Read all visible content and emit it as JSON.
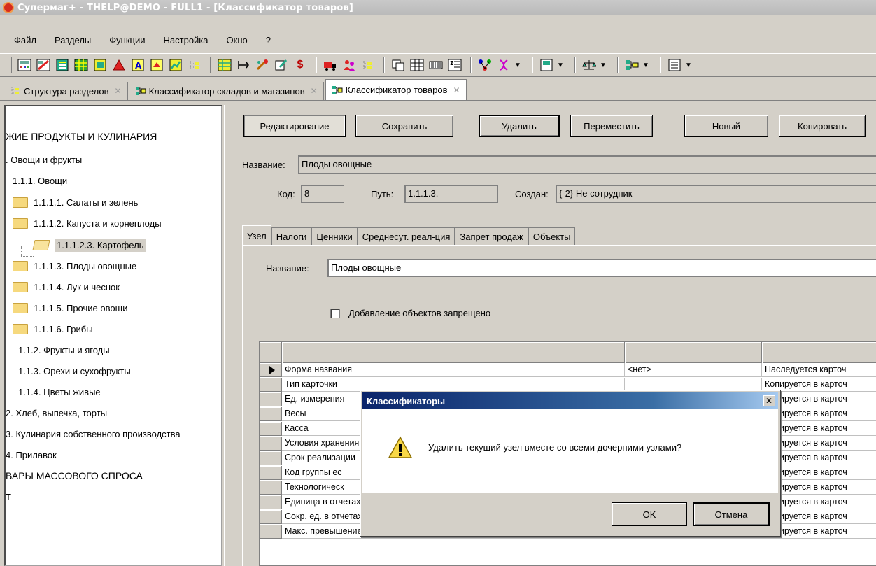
{
  "window": {
    "title": "Супермаг+ - THELP@DEMO - FULL1 - [Классификатор товаров]"
  },
  "menu": [
    "Файл",
    "Разделы",
    "Функции",
    "Настройка",
    "Окно",
    "?"
  ],
  "toolbar": {
    "icons": [
      "calc-icon",
      "calc-red-icon",
      "doc-green-icon",
      "table-green-icon",
      "doc-icon",
      "triangle-icon",
      "letter-a-icon",
      "hat-icon",
      "chart-icon",
      "tree-icon",
      "grid-icon",
      "tag-icon",
      "wand-icon",
      "edit-icon",
      "dollar-icon",
      "truck-icon",
      "people-icon",
      "tree-small-icon",
      "copy-icon",
      "calendar-icon",
      "barcode-icon",
      "sum-icon",
      "network-icon",
      "dna-icon",
      "save-drop-icon",
      "scales-drop-icon",
      "hierarchy-drop-icon",
      "list-drop-icon"
    ],
    "dollar": "$"
  },
  "doctabs": [
    {
      "label": "Структура разделов",
      "active": false
    },
    {
      "label": "Классификатор складов и магазинов",
      "active": false
    },
    {
      "label": "Классификатор товаров",
      "active": true
    }
  ],
  "tree": [
    {
      "label": "ЖИЕ ПРОДУКТЫ И КУЛИНАРИЯ",
      "level": 0,
      "folder": false
    },
    {
      "label": ". Овощи и фрукты",
      "level": 0,
      "folder": false
    },
    {
      "label": "1.1.1. Овощи",
      "level": 1,
      "folder": false
    },
    {
      "label": "1.1.1.1. Салаты и зелень",
      "level": 2,
      "folder": true
    },
    {
      "label": "1.1.1.2. Капуста и корнеплоды",
      "level": 2,
      "folder": true
    },
    {
      "label": "1.1.1.2.3. Картофель",
      "level": 3,
      "folder": true,
      "selected": true
    },
    {
      "label": "1.1.1.3. Плоды овощные",
      "level": 2,
      "folder": true
    },
    {
      "label": "1.1.1.4. Лук и чеснок",
      "level": 2,
      "folder": true
    },
    {
      "label": "1.1.1.5. Прочие овощи",
      "level": 2,
      "folder": true
    },
    {
      "label": "1.1.1.6. Грибы",
      "level": 2,
      "folder": true
    },
    {
      "label": "1.1.2. Фрукты и ягоды",
      "level": 1,
      "folder": false
    },
    {
      "label": "1.1.3. Орехи и сухофрукты",
      "level": 1,
      "folder": false
    },
    {
      "label": "1.1.4. Цветы живые",
      "level": 1,
      "folder": false
    },
    {
      "label": "2. Хлеб, выпечка, торты",
      "level": 0,
      "folder": false
    },
    {
      "label": "3. Кулинария собственного производства",
      "level": 0,
      "folder": false
    },
    {
      "label": "4. Прилавок",
      "level": 0,
      "folder": false
    },
    {
      "label": "ВАРЫ МАССОВОГО СПРОСА",
      "level": 0,
      "folder": false
    },
    {
      "label": "Т",
      "level": 0,
      "folder": false
    }
  ],
  "actions": {
    "edit": "Редактирование",
    "save": "Сохранить",
    "delete": "Удалить",
    "move": "Переместить",
    "new": "Новый",
    "copy": "Копировать"
  },
  "form": {
    "name_label": "Название:",
    "name_value": "Плоды овощные",
    "code_label": "Код:",
    "code_value": "8",
    "path_label": "Путь:",
    "path_value": "1.1.1.3.",
    "created_label": "Создан:",
    "created_value": "{-2} Не сотрудник"
  },
  "innertabs": [
    "Узел",
    "Налоги",
    "Ценники",
    "Среднесут. реал-ция",
    "Запрет продаж",
    "Объекты"
  ],
  "node": {
    "name_label": "Название:",
    "name_value": "Плоды овощные",
    "checkbox_label": "Добавление объектов запрещено"
  },
  "grid": {
    "rows": [
      {
        "name": "Форма названия",
        "value": "<нет>",
        "note": "Наследуется карточ"
      },
      {
        "name": "Тип карточки",
        "value": "",
        "note": "Копируется в карточ"
      },
      {
        "name": "Ед. измерения",
        "value": "",
        "note": "Копируется в карточ"
      },
      {
        "name": "Весы",
        "value": "",
        "note": "Копируется в карточ"
      },
      {
        "name": "Касса",
        "value": "",
        "note": "Копируется в карточ"
      },
      {
        "name": "Условия хранения",
        "value": "",
        "note": "Копируется в карточ"
      },
      {
        "name": "Срок реализации",
        "value": "",
        "note": "Копируется в карточ"
      },
      {
        "name": "Код группы ес",
        "value": "",
        "note": "Копируется в карточ"
      },
      {
        "name": "Технологическ",
        "value": "",
        "note": "Копируется в карточ"
      },
      {
        "name": "Единица в отчетах",
        "value": "",
        "note": "Копируется в карточ"
      },
      {
        "name": "Сокр. ед. в отчетах",
        "value": "",
        "note": "Копируется в карточ"
      },
      {
        "name": "Макс. превышение цены прихода (%)",
        "value": "",
        "note": "Копируется в карточ"
      }
    ]
  },
  "dialog": {
    "title": "Классификаторы",
    "close": "✕",
    "message": "Удалить текущий узел вместе со всеми дочерними узлами?",
    "ok": "OK",
    "cancel": "Отмена"
  }
}
